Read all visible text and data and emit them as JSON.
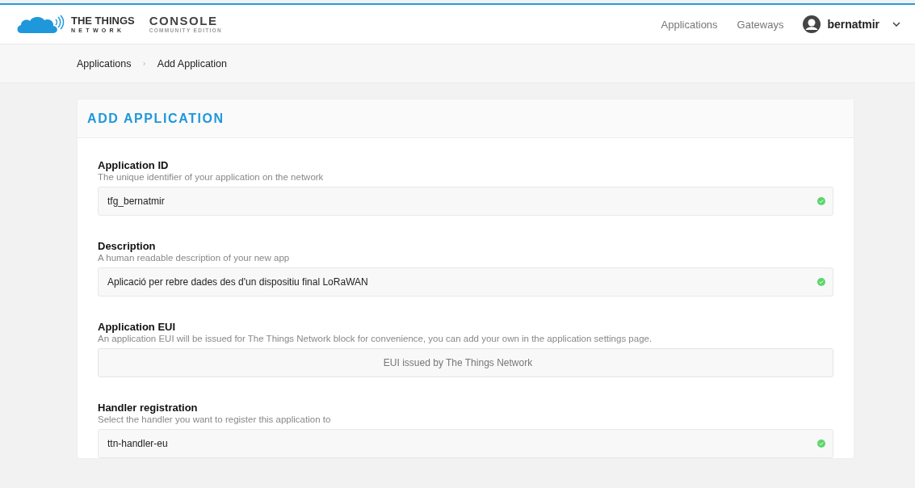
{
  "header": {
    "brand": {
      "line1": "THE THINGS",
      "line2": "NETWORK"
    },
    "product": {
      "line1": "CONSOLE",
      "line2": "COMMUNITY EDITION"
    },
    "nav": [
      "Applications",
      "Gateways"
    ],
    "user": "bernatmir"
  },
  "breadcrumb": {
    "items": [
      "Applications",
      "Add Application"
    ],
    "separator": "›"
  },
  "card": {
    "title": "ADD APPLICATION",
    "fields": [
      {
        "label": "Application ID",
        "description": "The unique identifier of your application on the network",
        "value": "tfg_bernatmir",
        "disabled": false,
        "valid": true
      },
      {
        "label": "Description",
        "description": "A human readable description of your new app",
        "value": "Aplicació per rebre dades des d'un dispositiu final LoRaWAN",
        "disabled": false,
        "valid": true
      },
      {
        "label": "Application EUI",
        "description": "An application EUI will be issued for The Things Network block for convenience, you can add your own in the application settings page.",
        "placeholder": "EUI issued by The Things Network",
        "disabled": true,
        "valid": false
      },
      {
        "label": "Handler registration",
        "description": "Select the handler you want to register this application to",
        "value": "ttn-handler-eu",
        "disabled": false,
        "valid": true
      }
    ]
  }
}
